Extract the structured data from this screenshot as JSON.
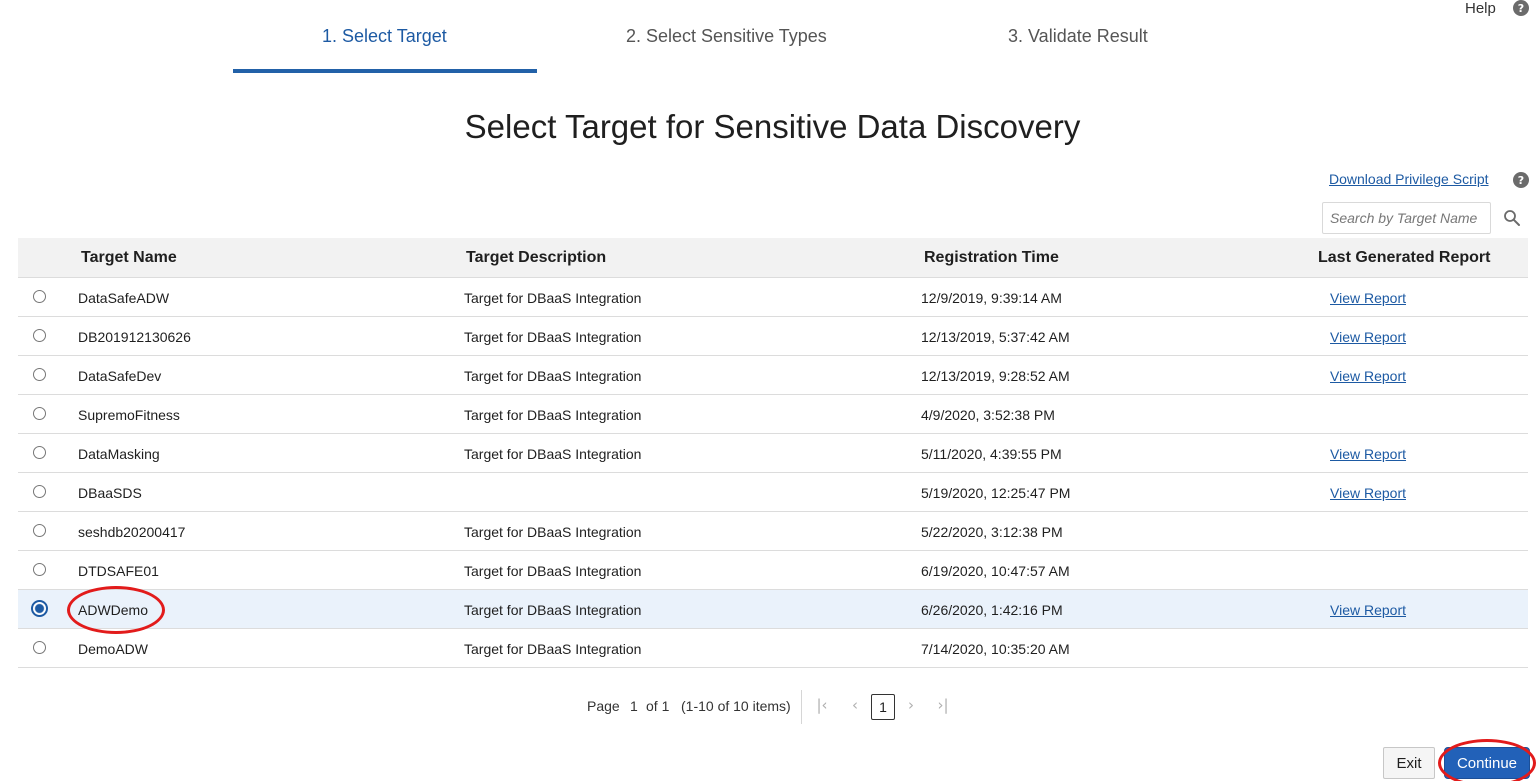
{
  "header": {
    "help_label": "Help",
    "help_icon": "question-circle-icon"
  },
  "steps": [
    {
      "label": "1. Select Target",
      "active": true
    },
    {
      "label": "2. Select Sensitive Types",
      "active": false
    },
    {
      "label": "3. Validate Result",
      "active": false
    }
  ],
  "page_title": "Select Target for Sensitive Data Discovery",
  "download_link": "Download Privilege Script",
  "search": {
    "placeholder": "Search by Target Name",
    "value": "",
    "icon": "search-icon"
  },
  "table": {
    "columns": [
      "Target Name",
      "Target Description",
      "Registration Time",
      "Last Generated Report"
    ],
    "rows": [
      {
        "name": "DataSafeADW",
        "description": "Target for DBaaS Integration",
        "time": "12/9/2019, 9:39:14 AM",
        "report": "View Report",
        "selected": false
      },
      {
        "name": "DB201912130626",
        "description": "Target for DBaaS Integration",
        "time": "12/13/2019, 5:37:42 AM",
        "report": "View Report",
        "selected": false
      },
      {
        "name": "DataSafeDev",
        "description": "Target for DBaaS Integration",
        "time": "12/13/2019, 9:28:52 AM",
        "report": "View Report",
        "selected": false
      },
      {
        "name": "SupremoFitness",
        "description": "Target for DBaaS Integration",
        "time": "4/9/2020, 3:52:38 PM",
        "report": "",
        "selected": false
      },
      {
        "name": "DataMasking",
        "description": "Target for DBaaS Integration",
        "time": "5/11/2020, 4:39:55 PM",
        "report": "View Report",
        "selected": false
      },
      {
        "name": "DBaaSDS",
        "description": "",
        "time": "5/19/2020, 12:25:47 PM",
        "report": "View Report",
        "selected": false
      },
      {
        "name": "seshdb20200417",
        "description": "Target for DBaaS Integration",
        "time": "5/22/2020, 3:12:38 PM",
        "report": "",
        "selected": false
      },
      {
        "name": "DTDSAFE01",
        "description": "Target for DBaaS Integration",
        "time": "6/19/2020, 10:47:57 AM",
        "report": "",
        "selected": false
      },
      {
        "name": "ADWDemo",
        "description": "Target for DBaaS Integration",
        "time": "6/26/2020, 1:42:16 PM",
        "report": "View Report",
        "selected": true
      },
      {
        "name": "DemoADW",
        "description": "Target for DBaaS Integration",
        "time": "7/14/2020, 10:35:20 AM",
        "report": "",
        "selected": false
      }
    ]
  },
  "pagination": {
    "page_label": "Page",
    "current": "1",
    "of_text": "of 1",
    "range_text": "(1-10 of 10 items)",
    "page_button": "1"
  },
  "footer": {
    "exit_label": "Exit",
    "continue_label": "Continue"
  },
  "colors": {
    "accent": "#1d5aa3",
    "primary_button": "#2261b8",
    "annotation": "#e21b1b",
    "selected_row": "#eaf2fb"
  }
}
